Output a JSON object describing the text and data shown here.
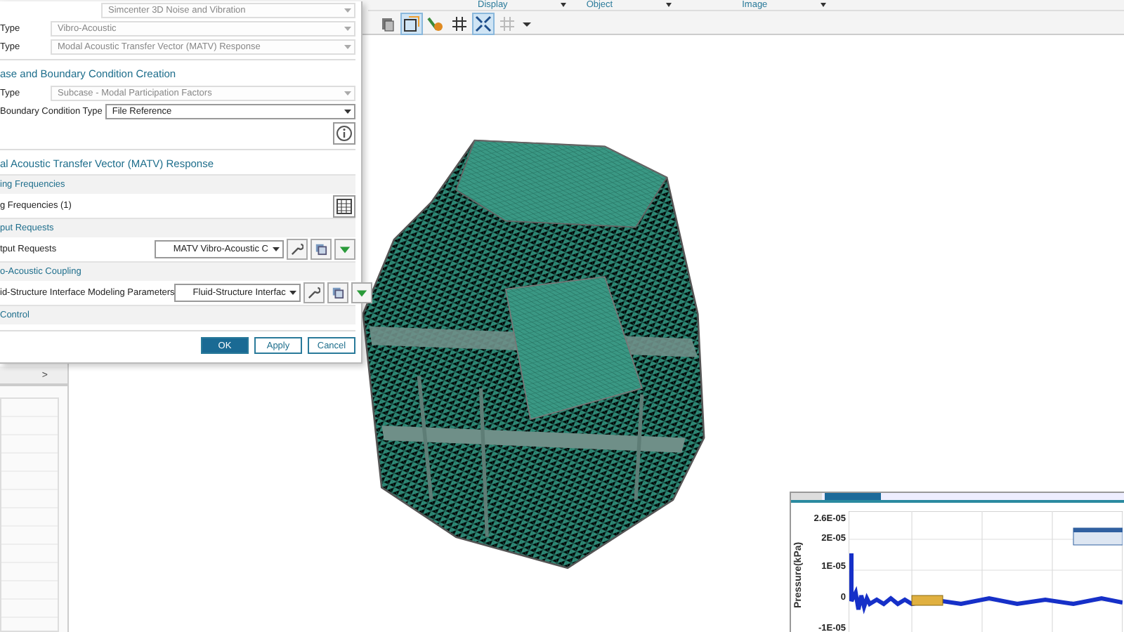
{
  "ribbon": {
    "groups": [
      {
        "label": "Display"
      },
      {
        "label": "Object"
      },
      {
        "label": "Image"
      }
    ],
    "tools": [
      {
        "kind": "menu",
        "selected": false
      },
      {
        "kind": "view",
        "selected": true
      },
      {
        "kind": "color",
        "selected": false
      },
      {
        "kind": "grid",
        "selected": false
      },
      {
        "kind": "fit",
        "selected": true
      },
      {
        "kind": "dots",
        "selected": false
      },
      {
        "kind": "caret",
        "selected": false
      }
    ]
  },
  "dialog": {
    "items": [
      {
        "kind": "select",
        "value": "Simcenter 3D Noise and Vibration",
        "disabled": true
      },
      {
        "kind": "select",
        "label": "Type",
        "value": "Vibro-Acoustic",
        "disabled": true
      },
      {
        "kind": "select",
        "label": "Type",
        "value": "Modal Acoustic Transfer Vector (MATV) Response",
        "disabled": true
      },
      {
        "kind": "section",
        "label": "ase and Boundary Condition Creation"
      },
      {
        "kind": "select",
        "label": "Type",
        "value": "Subcase - Modal Participation Factors",
        "disabled": true
      },
      {
        "kind": "select",
        "label": "Boundary Condition Type",
        "value": "File Reference",
        "disabled": false
      },
      {
        "kind": "info"
      },
      {
        "kind": "section",
        "label": "al Acoustic Transfer Vector (MATV) Response"
      },
      {
        "kind": "group",
        "label": "ing Frequencies"
      },
      {
        "kind": "table",
        "label": "g Frequencies (1)"
      },
      {
        "kind": "group",
        "label": "put Requests"
      },
      {
        "kind": "request",
        "label": "tput Requests",
        "value": "MATV Vibro-Acoustic C"
      },
      {
        "kind": "group",
        "label": "o-Acoustic Coupling"
      },
      {
        "kind": "request",
        "label": "id-Structure Interface Modeling Parameters",
        "value": "Fluid-Structure Interfac"
      },
      {
        "kind": "group",
        "label": "Control"
      }
    ],
    "buttons": [
      {
        "label": "OK",
        "primary": true
      },
      {
        "label": "Apply",
        "primary": false
      },
      {
        "label": "Cancel",
        "primary": false
      }
    ]
  },
  "navigator": {
    "expand_glyph": ">"
  },
  "plot": {
    "ylabel": "Pressure(kPa)",
    "yticks": [
      "2.6E-05",
      "2E-05",
      "1E-05",
      "0",
      "-1E-05"
    ]
  }
}
